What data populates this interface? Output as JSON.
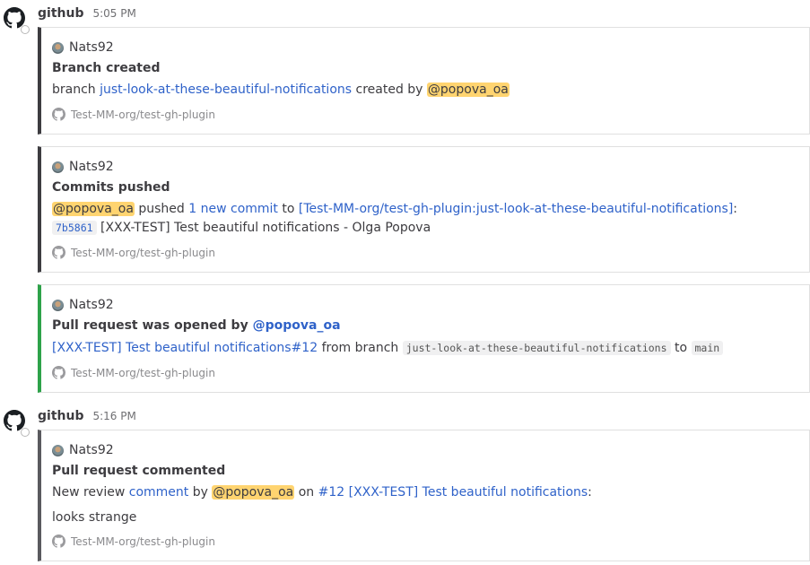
{
  "posts": [
    {
      "username": "github",
      "time": "5:05 PM",
      "attachments": [
        {
          "author": "Nats92",
          "title": "Branch created",
          "text": {
            "prefix": "branch ",
            "branch_link": "just-look-at-these-beautiful-notifications",
            "middle": " created by ",
            "mention": "@popova_oa"
          },
          "footer": "Test-MM-org/test-gh-plugin"
        },
        {
          "author": "Nats92",
          "title": "Commits pushed",
          "text": {
            "mention": "@popova_oa",
            "pushed": " pushed ",
            "commit_link": "1 new commit",
            "to": " to ",
            "ref_link": "[Test-MM-org/test-gh-plugin:just-look-at-these-beautiful-notifications]",
            "colon": ":",
            "sha": "7b5861",
            "commit_msg": "[XXX-TEST] Test beautiful notifications - Olga Popova"
          },
          "footer": "Test-MM-org/test-gh-plugin"
        },
        {
          "author": "Nats92",
          "title": {
            "prefix": "Pull request was opened by ",
            "mention": "@popova_oa"
          },
          "text": {
            "pr_link": "[XXX-TEST] Test beautiful notifications#12",
            "from_branch": " from branch ",
            "head_branch": "just-look-at-these-beautiful-notifications",
            "to": " to ",
            "base_branch": "main"
          },
          "footer": "Test-MM-org/test-gh-plugin"
        }
      ]
    },
    {
      "username": "github",
      "time": "5:16 PM",
      "attachments": [
        {
          "author": "Nats92",
          "title": "Pull request commented",
          "text": {
            "prefix": "New review ",
            "comment_link": "comment",
            "by": " by ",
            "mention": "@popova_oa",
            "on": " on ",
            "pr_link": "#12 [XXX-TEST] Test beautiful notifications",
            "colon": ":"
          },
          "body": "looks strange",
          "footer": "Test-MM-org/test-gh-plugin"
        }
      ]
    }
  ],
  "colors": {
    "link": "#2f62c9",
    "mention_bg": "#ffd470",
    "border_dark": "#3d3c40",
    "border_green": "#2ea24a"
  },
  "icons": [
    "github-icon",
    "github-footer-icon",
    "user-avatar"
  ]
}
